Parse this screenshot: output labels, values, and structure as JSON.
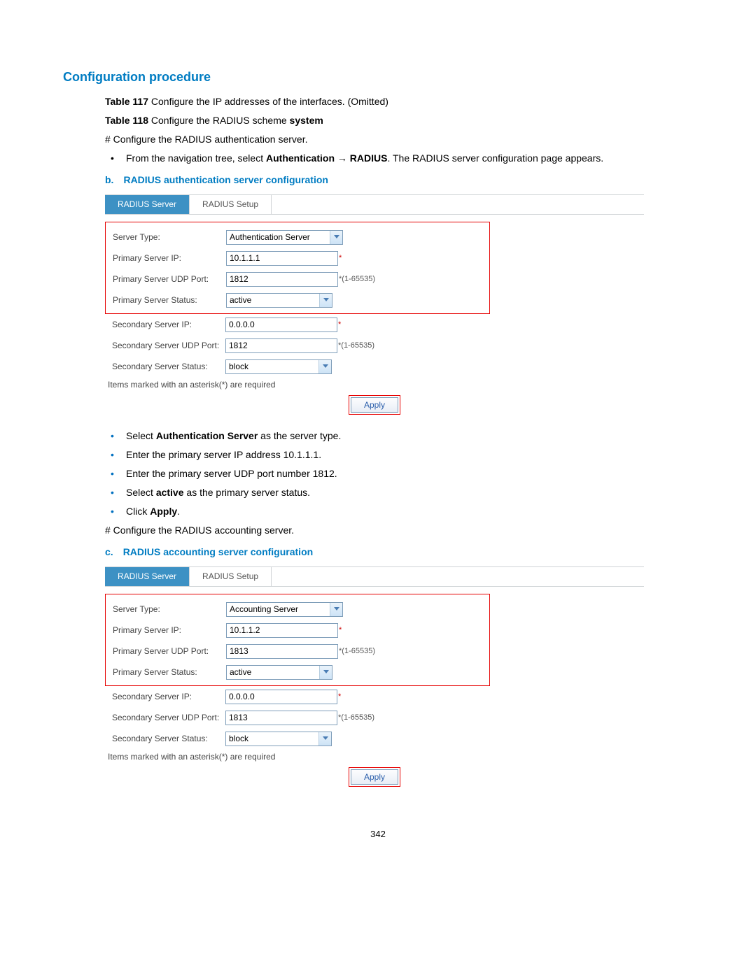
{
  "heading": "Configuration procedure",
  "line1": {
    "prefix": "Table 117",
    "text": " Configure the IP addresses of the interfaces. (Omitted)"
  },
  "line2": {
    "prefix": "Table 118",
    "mid": " Configure the RADIUS scheme ",
    "bold": "system"
  },
  "hash1": "# Configure the RADIUS authentication server.",
  "nav_bullet": {
    "pre": "From the navigation tree, select ",
    "b1": "Authentication",
    "arrow": " → ",
    "b2": "RADIUS",
    "post": ". The RADIUS server configuration page appears."
  },
  "sub_b": {
    "letter": "b.",
    "text": "RADIUS authentication server configuration"
  },
  "tabs": {
    "active": "RADIUS Server",
    "other": "RADIUS Setup"
  },
  "labels": {
    "server_type": "Server Type:",
    "primary_ip": "Primary Server IP:",
    "primary_port": "Primary Server UDP Port:",
    "primary_status": "Primary Server Status:",
    "secondary_ip": "Secondary Server IP:",
    "secondary_port": "Secondary Server UDP Port:",
    "secondary_status": "Secondary Server Status:"
  },
  "auth": {
    "server_type": "Authentication Server",
    "primary_ip": "10.1.1.1",
    "primary_port": "1812",
    "primary_status": "active",
    "secondary_ip": "0.0.0.0",
    "secondary_port": "1812",
    "secondary_status": "block"
  },
  "hints": {
    "star": "*",
    "port_range": "*(1-65535)"
  },
  "footnote": "Items marked with an asterisk(*) are required",
  "apply": "Apply",
  "bullets_mid": [
    {
      "pre": "Select ",
      "b": "Authentication Server",
      "post": " as the server type."
    },
    {
      "pre": "Enter the primary server IP address 10.1.1.1.",
      "b": "",
      "post": ""
    },
    {
      "pre": "Enter the primary server UDP port number 1812.",
      "b": "",
      "post": ""
    },
    {
      "pre": "Select ",
      "b": "active",
      "post": " as the primary server status."
    },
    {
      "pre": "Click ",
      "b": "Apply",
      "post": "."
    }
  ],
  "hash2": "# Configure the RADIUS accounting server.",
  "sub_c": {
    "letter": "c.",
    "text": "RADIUS accounting server configuration"
  },
  "acct": {
    "server_type": "Accounting Server",
    "primary_ip": "10.1.1.2",
    "primary_port": "1813",
    "primary_status": "active",
    "secondary_ip": "0.0.0.0",
    "secondary_port": "1813",
    "secondary_status": "block"
  },
  "page_number": "342"
}
